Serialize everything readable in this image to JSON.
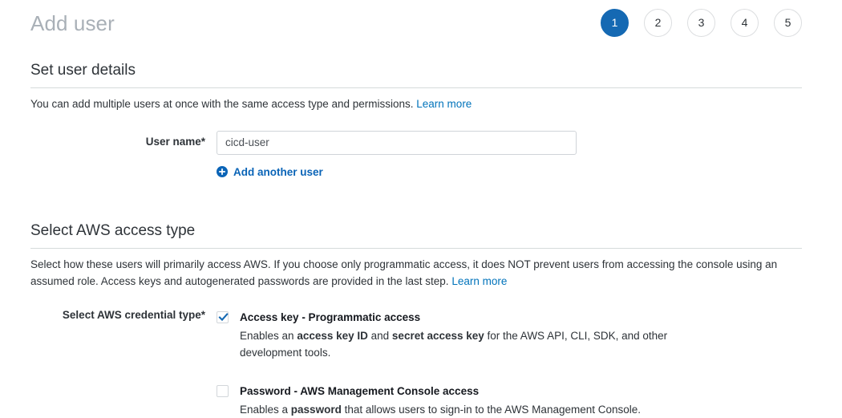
{
  "header": {
    "title": "Add user",
    "steps": [
      {
        "number": "1",
        "active": true
      },
      {
        "number": "2",
        "active": false
      },
      {
        "number": "3",
        "active": false
      },
      {
        "number": "4",
        "active": false
      },
      {
        "number": "5",
        "active": false
      }
    ]
  },
  "user_details": {
    "section_title": "Set user details",
    "description": "You can add multiple users at once with the same access type and permissions.",
    "learn_more": "Learn more",
    "username_label": "User name*",
    "username_value": "cicd-user",
    "username_placeholder": "",
    "add_another_user": "Add another user",
    "plus_icon": "plus-circle-icon"
  },
  "access_type": {
    "section_title": "Select AWS access type",
    "description_part1": "Select how these users will primarily access AWS. If you choose only programmatic access, it does NOT prevent users from accessing the console using an assumed role. Access keys and autogenerated passwords are provided in the last step.",
    "learn_more": "Learn more",
    "credential_label": "Select AWS credential type*",
    "options": [
      {
        "checked": true,
        "title": "Access key - Programmatic access",
        "desc_1": "Enables an ",
        "desc_bold_1": "access key ID",
        "desc_2": " and ",
        "desc_bold_2": "secret access key",
        "desc_3": " for the AWS API, CLI, SDK, and other development tools."
      },
      {
        "checked": false,
        "title": "Password - AWS Management Console access",
        "desc_1": "Enables a ",
        "desc_bold_1": "password",
        "desc_2": " that allows users to sign-in to the AWS Management Console.",
        "desc_bold_2": "",
        "desc_3": ""
      }
    ]
  },
  "colors": {
    "accent_blue": "#0073bb",
    "step_active": "#1569b3",
    "link_blue": "#0a64b7",
    "title_gray": "#a9b0b7",
    "rule_gray": "#d5dbdb",
    "text_dark": "#16191f"
  }
}
